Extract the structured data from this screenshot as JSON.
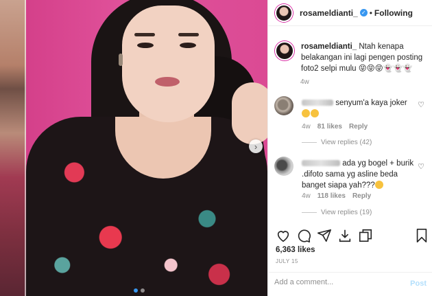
{
  "post": {
    "username": "rosameldianti_",
    "follow_label": "Following",
    "separator": "•",
    "verified_mark": "✓",
    "caption": {
      "username": "rosameldianti_",
      "text": "Ntah kenapa belakangan ini lagi pengen posting foto2 selpi mulu 😝😝😝👻👻👻",
      "time": "4w"
    },
    "likes": "6,363 likes",
    "date": "JULY 15",
    "add_comment_placeholder": "Add a comment...",
    "post_label": "Post"
  },
  "comments": [
    {
      "text": "senyum'a kaya joker",
      "emoji_text": "",
      "time": "4w",
      "likes": "81 likes",
      "reply_label": "Reply",
      "view_replies": "View replies (42)"
    },
    {
      "text": "ada yg bogel + burik .difoto sama yg asline beda banget siapa yah???",
      "time": "4w",
      "likes": "118 likes",
      "reply_label": "Reply",
      "view_replies": "View replies (19)"
    }
  ],
  "icons": {
    "heart": "♡",
    "next": "›"
  },
  "colors": {
    "accent": "#3897f0",
    "backdrop": "#d9468c",
    "post_disabled": "#b2dffc"
  }
}
